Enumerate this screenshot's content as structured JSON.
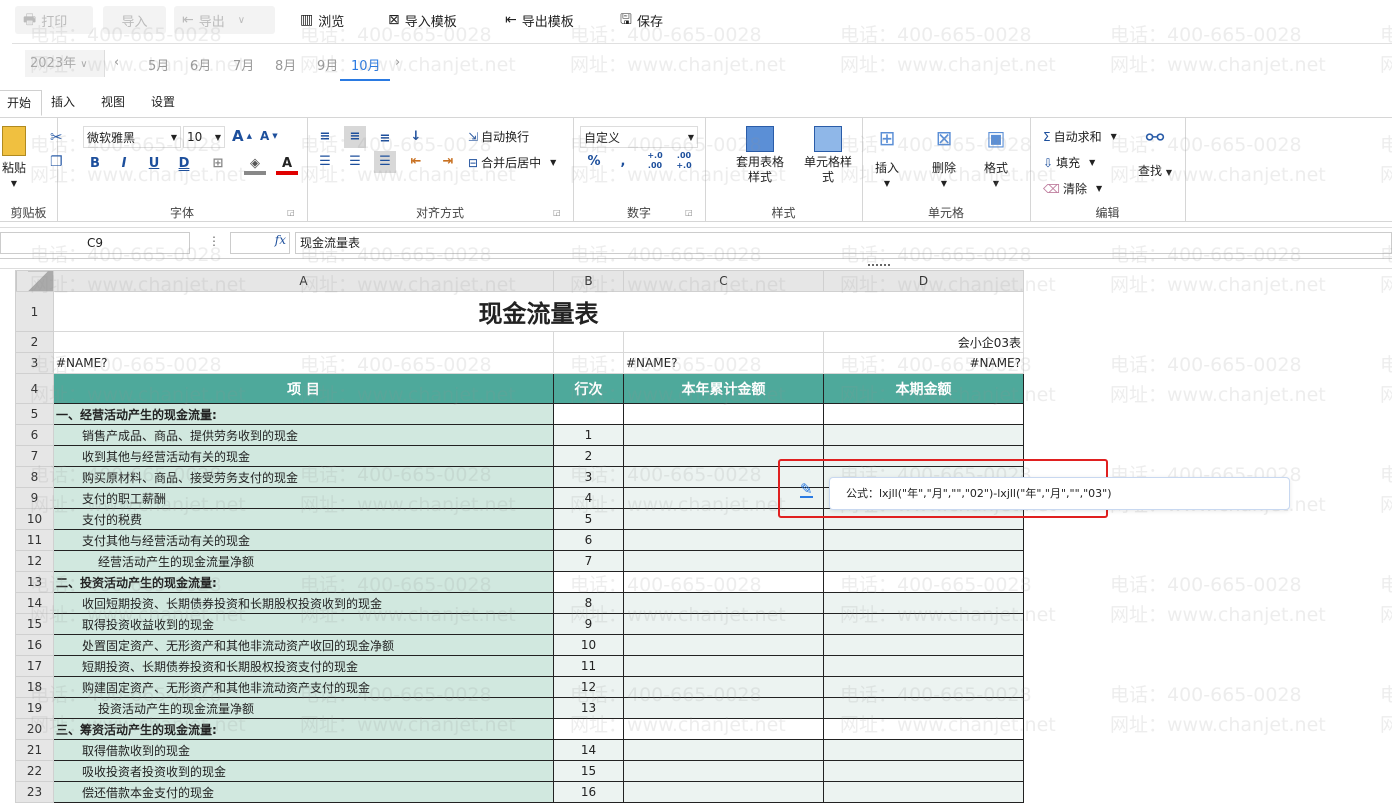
{
  "toolbar": {
    "print": "打印",
    "import": "导入",
    "export": "导出",
    "browse": "浏览",
    "import_template": "导入模板",
    "export_template": "导出模板",
    "save": "保存"
  },
  "period": {
    "year": "2023年",
    "months": [
      "5月",
      "6月",
      "7月",
      "8月",
      "9月",
      "10月"
    ],
    "active": "10月"
  },
  "menu_tabs": [
    "开始",
    "插入",
    "视图",
    "设置"
  ],
  "ribbon": {
    "clipboard": {
      "paste": "粘贴",
      "label": "剪贴板"
    },
    "font": {
      "name": "微软雅黑",
      "size": "10",
      "bold": "B",
      "italic": "I",
      "underline": "U",
      "double_underline": "D",
      "label": "字体"
    },
    "align": {
      "wrap": "自动换行",
      "merge": "合并后居中",
      "label": "对齐方式"
    },
    "number": {
      "format": "自定义",
      "percent": "%",
      "comma": ",",
      "inc": "+.0 .00",
      "dec": ".00 +.0",
      "label": "数字"
    },
    "styles": {
      "table_style": "套用表格样式",
      "cell_style": "单元格样式",
      "label": "样式"
    },
    "cells": {
      "insert": "插入",
      "delete": "删除",
      "format": "格式",
      "label": "单元格"
    },
    "editing": {
      "autosum": "自动求和",
      "fill": "填充",
      "clear": "清除",
      "find": "查找",
      "label": "编辑"
    }
  },
  "formula_bar": {
    "cell_ref": "C9",
    "fx": "fx",
    "value": "现金流量表"
  },
  "sheet": {
    "columns": [
      "A",
      "B",
      "C",
      "D"
    ],
    "title": "现金流量表",
    "form_code": "会小企03表",
    "name_error": "#NAME?",
    "headers": [
      "项 目",
      "行次",
      "本年累计金额",
      "本期金额"
    ],
    "rows": [
      {
        "n": "5",
        "item": "一、经营活动产生的现金流量:",
        "line": "",
        "type": "section"
      },
      {
        "n": "6",
        "item": "销售产成品、商品、提供劳务收到的现金",
        "line": "1",
        "type": "item"
      },
      {
        "n": "7",
        "item": "收到其他与经营活动有关的现金",
        "line": "2",
        "type": "item"
      },
      {
        "n": "8",
        "item": "购买原材料、商品、接受劳务支付的现金",
        "line": "3",
        "type": "item"
      },
      {
        "n": "9",
        "item": "支付的职工薪酬",
        "line": "4",
        "type": "item"
      },
      {
        "n": "10",
        "item": "支付的税费",
        "line": "5",
        "type": "item"
      },
      {
        "n": "11",
        "item": "支付其他与经营活动有关的现金",
        "line": "6",
        "type": "item"
      },
      {
        "n": "12",
        "item": "经营活动产生的现金流量净额",
        "line": "7",
        "type": "total"
      },
      {
        "n": "13",
        "item": "二、投资活动产生的现金流量:",
        "line": "",
        "type": "section"
      },
      {
        "n": "14",
        "item": "收回短期投资、长期债券投资和长期股权投资收到的现金",
        "line": "8",
        "type": "item"
      },
      {
        "n": "15",
        "item": "取得投资收益收到的现金",
        "line": "9",
        "type": "item"
      },
      {
        "n": "16",
        "item": "处置固定资产、无形资产和其他非流动资产收回的现金净额",
        "line": "10",
        "type": "item"
      },
      {
        "n": "17",
        "item": "短期投资、长期债券投资和长期股权投资支付的现金",
        "line": "11",
        "type": "item"
      },
      {
        "n": "18",
        "item": "购建固定资产、无形资产和其他非流动资产支付的现金",
        "line": "12",
        "type": "item"
      },
      {
        "n": "19",
        "item": "投资活动产生的现金流量净额",
        "line": "13",
        "type": "total"
      },
      {
        "n": "20",
        "item": "三、筹资活动产生的现金流量:",
        "line": "",
        "type": "section"
      },
      {
        "n": "21",
        "item": "取得借款收到的现金",
        "line": "14",
        "type": "item"
      },
      {
        "n": "22",
        "item": "吸收投资者投资收到的现金",
        "line": "15",
        "type": "item"
      },
      {
        "n": "23",
        "item": "偿还借款本金支付的现金",
        "line": "16",
        "type": "item"
      }
    ]
  },
  "tooltip": {
    "formula": "公式：lxjll(\"年\",\"月\",\"\",\"02\")-lxjll(\"年\",\"月\",\"\",\"03\")"
  },
  "watermark": {
    "phone": "电话：400-665-0028",
    "site": "网址：www.chanjet.net"
  },
  "colors": {
    "teal": "#4ea99b",
    "accent": "#2a7ae2",
    "highlight": "#e02020"
  }
}
